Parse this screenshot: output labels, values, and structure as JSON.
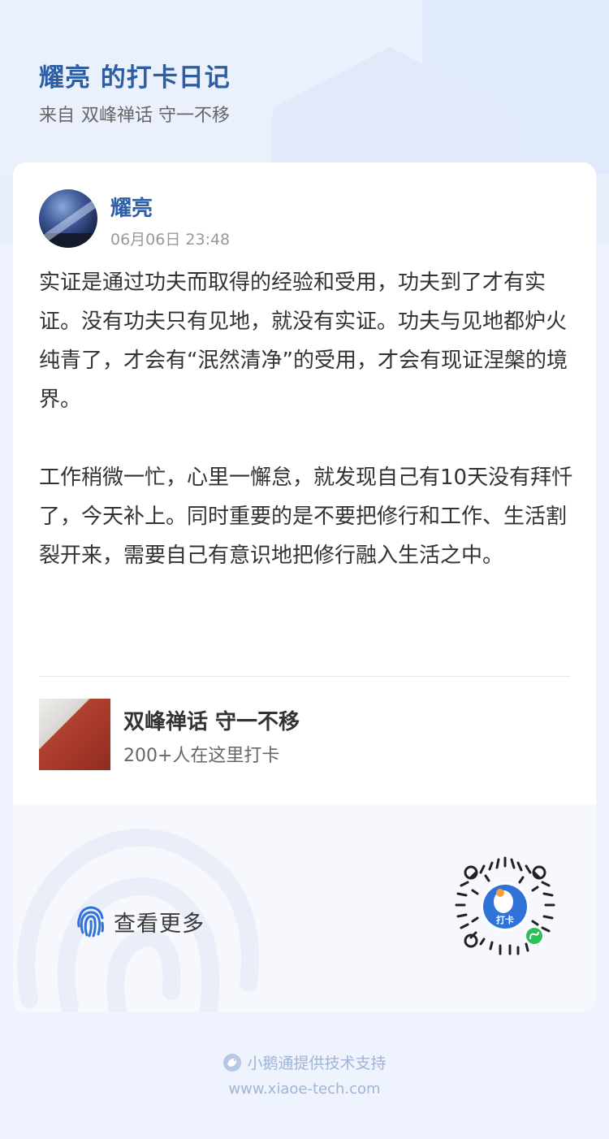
{
  "header": {
    "title": "耀亮 的打卡日记",
    "from_prefix": "来自",
    "group_name": "双峰禅话 守一不移"
  },
  "post": {
    "author": "耀亮",
    "time": "06月06日 23:48",
    "paragraphs": [
      "实证是通过功夫而取得的经验和受用，功夫到了才有实证。没有功夫只有见地，就没有实证。功夫与见地都炉火纯青了，才会有“泯然清净”的受用，才会有现证涅槃的境界。",
      "工作稍微一忙，心里一懈怠，就发现自己有10天没有拜忏了，今天补上。同时重要的是不要把修行和工作、生活割裂开来，需要自己有意识地把修行融入生活之中。"
    ]
  },
  "group_card": {
    "name": "双峰禅话 守一不移",
    "count_text": "200+人在这里打卡"
  },
  "bottom": {
    "view_more_label": "查看更多",
    "qr_badge": "打卡"
  },
  "footer": {
    "brand_text": "小鹅通提供技术支持",
    "url": "www.xiaoe-tech.com"
  },
  "colors": {
    "accent": "#2d5ea3",
    "background": "#eef3fd",
    "footer_text": "#9fb4d6",
    "mini_program_green": "#2dbf5a"
  },
  "icons": {
    "fingerprint": "fingerprint-icon",
    "logo": "xiaoe-logo-icon",
    "mini_program": "mini-program-icon"
  }
}
